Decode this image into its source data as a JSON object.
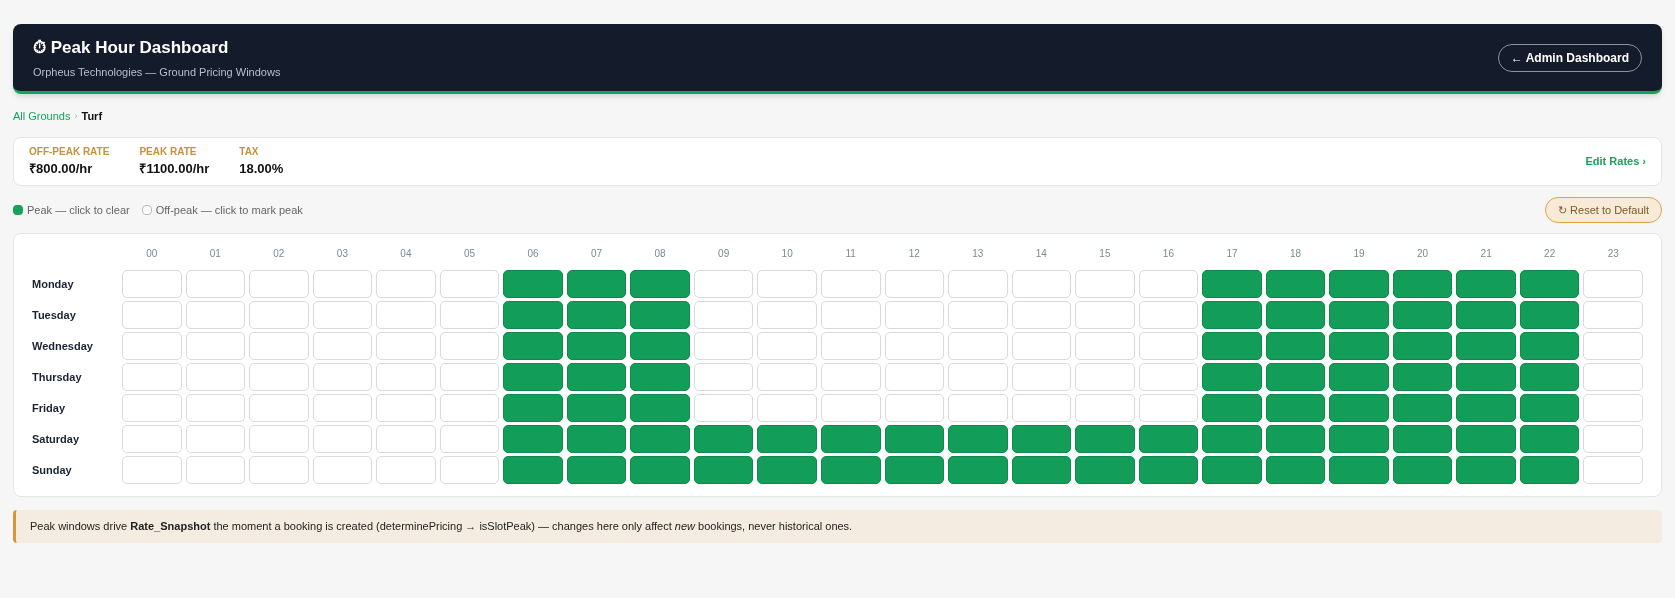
{
  "header": {
    "title": "⏱ Peak Hour Dashboard",
    "subtitle": "Orpheus Technologies — Ground Pricing Windows",
    "back_button": "← Admin Dashboard"
  },
  "breadcrumb": {
    "parent": "All Grounds",
    "separator": "›",
    "current": "Turf"
  },
  "rates": [
    {
      "label": "OFF-PEAK RATE",
      "value": "₹800.00/hr"
    },
    {
      "label": "PEAK RATE",
      "value": "₹1100.00/hr"
    },
    {
      "label": "TAX",
      "value": "18.00%"
    }
  ],
  "edit_rates": "Edit Rates ›",
  "legend": [
    {
      "label": "Peak — click to clear",
      "peak": true
    },
    {
      "label": "Off-peak — click to mark peak",
      "peak": false
    }
  ],
  "reset_button": "↻ Reset to Default",
  "hours": [
    "00",
    "01",
    "02",
    "03",
    "04",
    "05",
    "06",
    "07",
    "08",
    "09",
    "10",
    "11",
    "12",
    "13",
    "14",
    "15",
    "16",
    "17",
    "18",
    "19",
    "20",
    "21",
    "22",
    "23"
  ],
  "rows": [
    {
      "day": "Monday",
      "cells": [
        {
          "peak": false
        },
        {
          "peak": false
        },
        {
          "peak": false
        },
        {
          "peak": false
        },
        {
          "peak": false
        },
        {
          "peak": false
        },
        {
          "peak": true
        },
        {
          "peak": true
        },
        {
          "peak": true
        },
        {
          "peak": false
        },
        {
          "peak": false
        },
        {
          "peak": false
        },
        {
          "peak": false
        },
        {
          "peak": false
        },
        {
          "peak": false
        },
        {
          "peak": false
        },
        {
          "peak": false
        },
        {
          "peak": true
        },
        {
          "peak": true
        },
        {
          "peak": true
        },
        {
          "peak": true
        },
        {
          "peak": true
        },
        {
          "peak": true
        },
        {
          "peak": false
        }
      ]
    },
    {
      "day": "Tuesday",
      "cells": [
        {
          "peak": false
        },
        {
          "peak": false
        },
        {
          "peak": false
        },
        {
          "peak": false
        },
        {
          "peak": false
        },
        {
          "peak": false
        },
        {
          "peak": true
        },
        {
          "peak": true
        },
        {
          "peak": true
        },
        {
          "peak": false
        },
        {
          "peak": false
        },
        {
          "peak": false
        },
        {
          "peak": false
        },
        {
          "peak": false
        },
        {
          "peak": false
        },
        {
          "peak": false
        },
        {
          "peak": false
        },
        {
          "peak": true
        },
        {
          "peak": true
        },
        {
          "peak": true
        },
        {
          "peak": true
        },
        {
          "peak": true
        },
        {
          "peak": true
        },
        {
          "peak": false
        }
      ]
    },
    {
      "day": "Wednesday",
      "cells": [
        {
          "peak": false
        },
        {
          "peak": false
        },
        {
          "peak": false
        },
        {
          "peak": false
        },
        {
          "peak": false
        },
        {
          "peak": false
        },
        {
          "peak": true
        },
        {
          "peak": true
        },
        {
          "peak": true
        },
        {
          "peak": false
        },
        {
          "peak": false
        },
        {
          "peak": false
        },
        {
          "peak": false
        },
        {
          "peak": false
        },
        {
          "peak": false
        },
        {
          "peak": false
        },
        {
          "peak": false
        },
        {
          "peak": true
        },
        {
          "peak": true
        },
        {
          "peak": true
        },
        {
          "peak": true
        },
        {
          "peak": true
        },
        {
          "peak": true
        },
        {
          "peak": false
        }
      ]
    },
    {
      "day": "Thursday",
      "cells": [
        {
          "peak": false
        },
        {
          "peak": false
        },
        {
          "peak": false
        },
        {
          "peak": false
        },
        {
          "peak": false
        },
        {
          "peak": false
        },
        {
          "peak": true
        },
        {
          "peak": true
        },
        {
          "peak": true
        },
        {
          "peak": false
        },
        {
          "peak": false
        },
        {
          "peak": false
        },
        {
          "peak": false
        },
        {
          "peak": false
        },
        {
          "peak": false
        },
        {
          "peak": false
        },
        {
          "peak": false
        },
        {
          "peak": true
        },
        {
          "peak": true
        },
        {
          "peak": true
        },
        {
          "peak": true
        },
        {
          "peak": true
        },
        {
          "peak": true
        },
        {
          "peak": false
        }
      ]
    },
    {
      "day": "Friday",
      "cells": [
        {
          "peak": false
        },
        {
          "peak": false
        },
        {
          "peak": false
        },
        {
          "peak": false
        },
        {
          "peak": false
        },
        {
          "peak": false
        },
        {
          "peak": true
        },
        {
          "peak": true
        },
        {
          "peak": true
        },
        {
          "peak": false
        },
        {
          "peak": false
        },
        {
          "peak": false
        },
        {
          "peak": false
        },
        {
          "peak": false
        },
        {
          "peak": false
        },
        {
          "peak": false
        },
        {
          "peak": false
        },
        {
          "peak": true
        },
        {
          "peak": true
        },
        {
          "peak": true
        },
        {
          "peak": true
        },
        {
          "peak": true
        },
        {
          "peak": true
        },
        {
          "peak": false
        }
      ]
    },
    {
      "day": "Saturday",
      "cells": [
        {
          "peak": false
        },
        {
          "peak": false
        },
        {
          "peak": false
        },
        {
          "peak": false
        },
        {
          "peak": false
        },
        {
          "peak": false
        },
        {
          "peak": true
        },
        {
          "peak": true
        },
        {
          "peak": true
        },
        {
          "peak": true
        },
        {
          "peak": true
        },
        {
          "peak": true
        },
        {
          "peak": true
        },
        {
          "peak": true
        },
        {
          "peak": true
        },
        {
          "peak": true
        },
        {
          "peak": true
        },
        {
          "peak": true
        },
        {
          "peak": true
        },
        {
          "peak": true
        },
        {
          "peak": true
        },
        {
          "peak": true
        },
        {
          "peak": true
        },
        {
          "peak": false
        }
      ]
    },
    {
      "day": "Sunday",
      "cells": [
        {
          "peak": false
        },
        {
          "peak": false
        },
        {
          "peak": false
        },
        {
          "peak": false
        },
        {
          "peak": false
        },
        {
          "peak": false
        },
        {
          "peak": true
        },
        {
          "peak": true
        },
        {
          "peak": true
        },
        {
          "peak": true
        },
        {
          "peak": true
        },
        {
          "peak": true
        },
        {
          "peak": true
        },
        {
          "peak": true
        },
        {
          "peak": true
        },
        {
          "peak": true
        },
        {
          "peak": true
        },
        {
          "peak": true
        },
        {
          "peak": true
        },
        {
          "peak": true
        },
        {
          "peak": true
        },
        {
          "peak": true
        },
        {
          "peak": true
        },
        {
          "peak": false
        }
      ]
    }
  ],
  "note": "Peak windows drive **Rate_Snapshot** the moment a booking is created (determinePricing → isSlotPeak) — changes here only affect *new* bookings, never historical ones."
}
